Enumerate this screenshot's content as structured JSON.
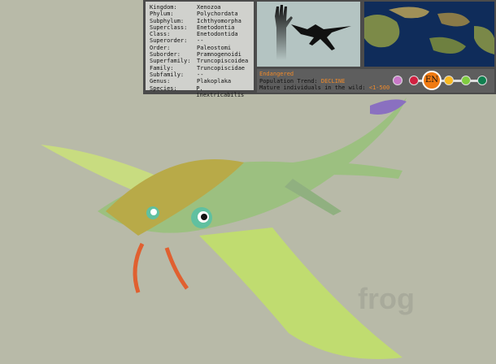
{
  "taxonomy": [
    {
      "rank": "Kingdom:",
      "value": "Xenozoa"
    },
    {
      "rank": "Phylum:",
      "value": "Polychordata"
    },
    {
      "rank": "Subphylum:",
      "value": "Ichthyomorpha"
    },
    {
      "rank": "Superclass:",
      "value": "Enetodontia"
    },
    {
      "rank": "Class:",
      "value": "Enetodontida"
    },
    {
      "rank": "Superorder:",
      "value": "--"
    },
    {
      "rank": "Order:",
      "value": "Paleostomi"
    },
    {
      "rank": "Suborder:",
      "value": "Pramnogenoidi"
    },
    {
      "rank": "Superfamily:",
      "value": "Truncopiscoidea"
    },
    {
      "rank": "Family:",
      "value": "Truncopiscidae"
    },
    {
      "rank": "Subfamily:",
      "value": "--"
    },
    {
      "rank": "Genus:",
      "value": "Plakoplaka"
    },
    {
      "rank": "Species:",
      "value": "P. inextricabilis"
    }
  ],
  "status": {
    "category": "Endangered",
    "trend_label": "Population Trend:",
    "trend": "DECLINE",
    "mature_label": "Mature individuals in the wild:",
    "mature": "<1-500",
    "badge": "EN",
    "colors": [
      "#c878c8",
      "#d02040",
      "#f07a12",
      "#f8b820",
      "#80cc40",
      "#108050"
    ]
  }
}
